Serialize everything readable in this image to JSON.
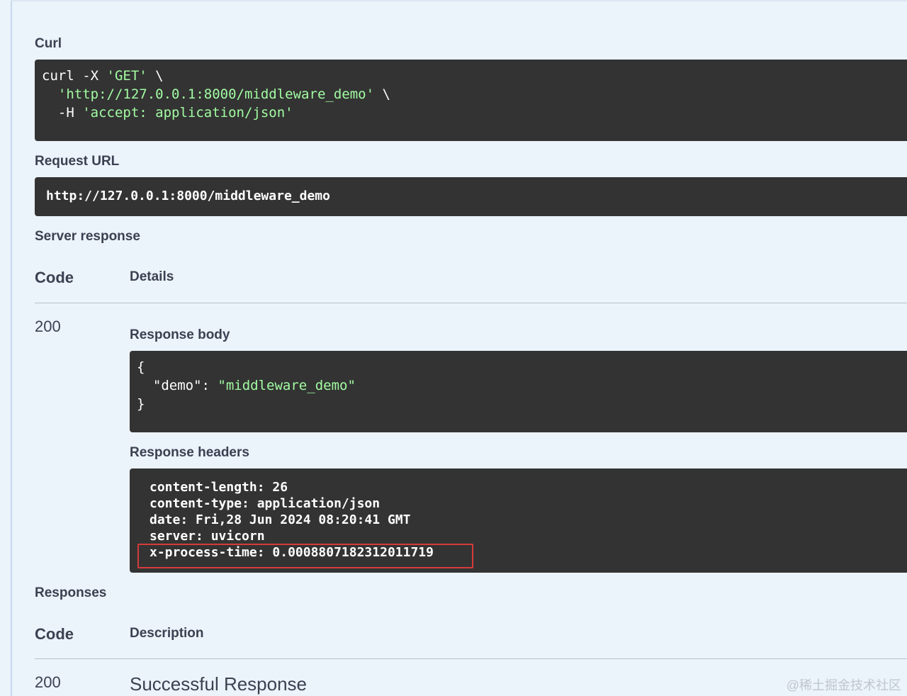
{
  "curl": {
    "label": "Curl",
    "line1_prefix": "curl -X ",
    "line1_method": "'GET'",
    "line1_suffix": " \\",
    "line2_indent": "  ",
    "line2_url": "'http://127.0.0.1:8000/middleware_demo'",
    "line2_suffix": " \\",
    "line3_prefix": "  -H ",
    "line3_header": "'accept: application/json'"
  },
  "request_url": {
    "label": "Request URL",
    "value": "http://127.0.0.1:8000/middleware_demo"
  },
  "server_response": {
    "label": "Server response",
    "col_code": "Code",
    "col_details": "Details",
    "code": "200",
    "body_label": "Response body",
    "body_open": "{",
    "body_key_indent": "  ",
    "body_key": "\"demo\"",
    "body_colon": ": ",
    "body_value": "\"middleware_demo\"",
    "body_close": "}",
    "headers_label": "Response headers",
    "headers": [
      "content-length: 26",
      "content-type: application/json",
      "date: Fri,28 Jun 2024 08:20:41 GMT",
      "server: uvicorn",
      "x-process-time: 0.0008807182312011719"
    ],
    "highlight_color": "#d63b3b"
  },
  "responses": {
    "label": "Responses",
    "col_code": "Code",
    "col_description": "Description",
    "code": "200",
    "description": "Successful Response"
  },
  "watermark": "@稀土掘金技术社区",
  "colors": {
    "background": "#ebf3fb",
    "code_bg": "#333333",
    "string_green": "#a2fca2",
    "text": "#3b4151"
  }
}
